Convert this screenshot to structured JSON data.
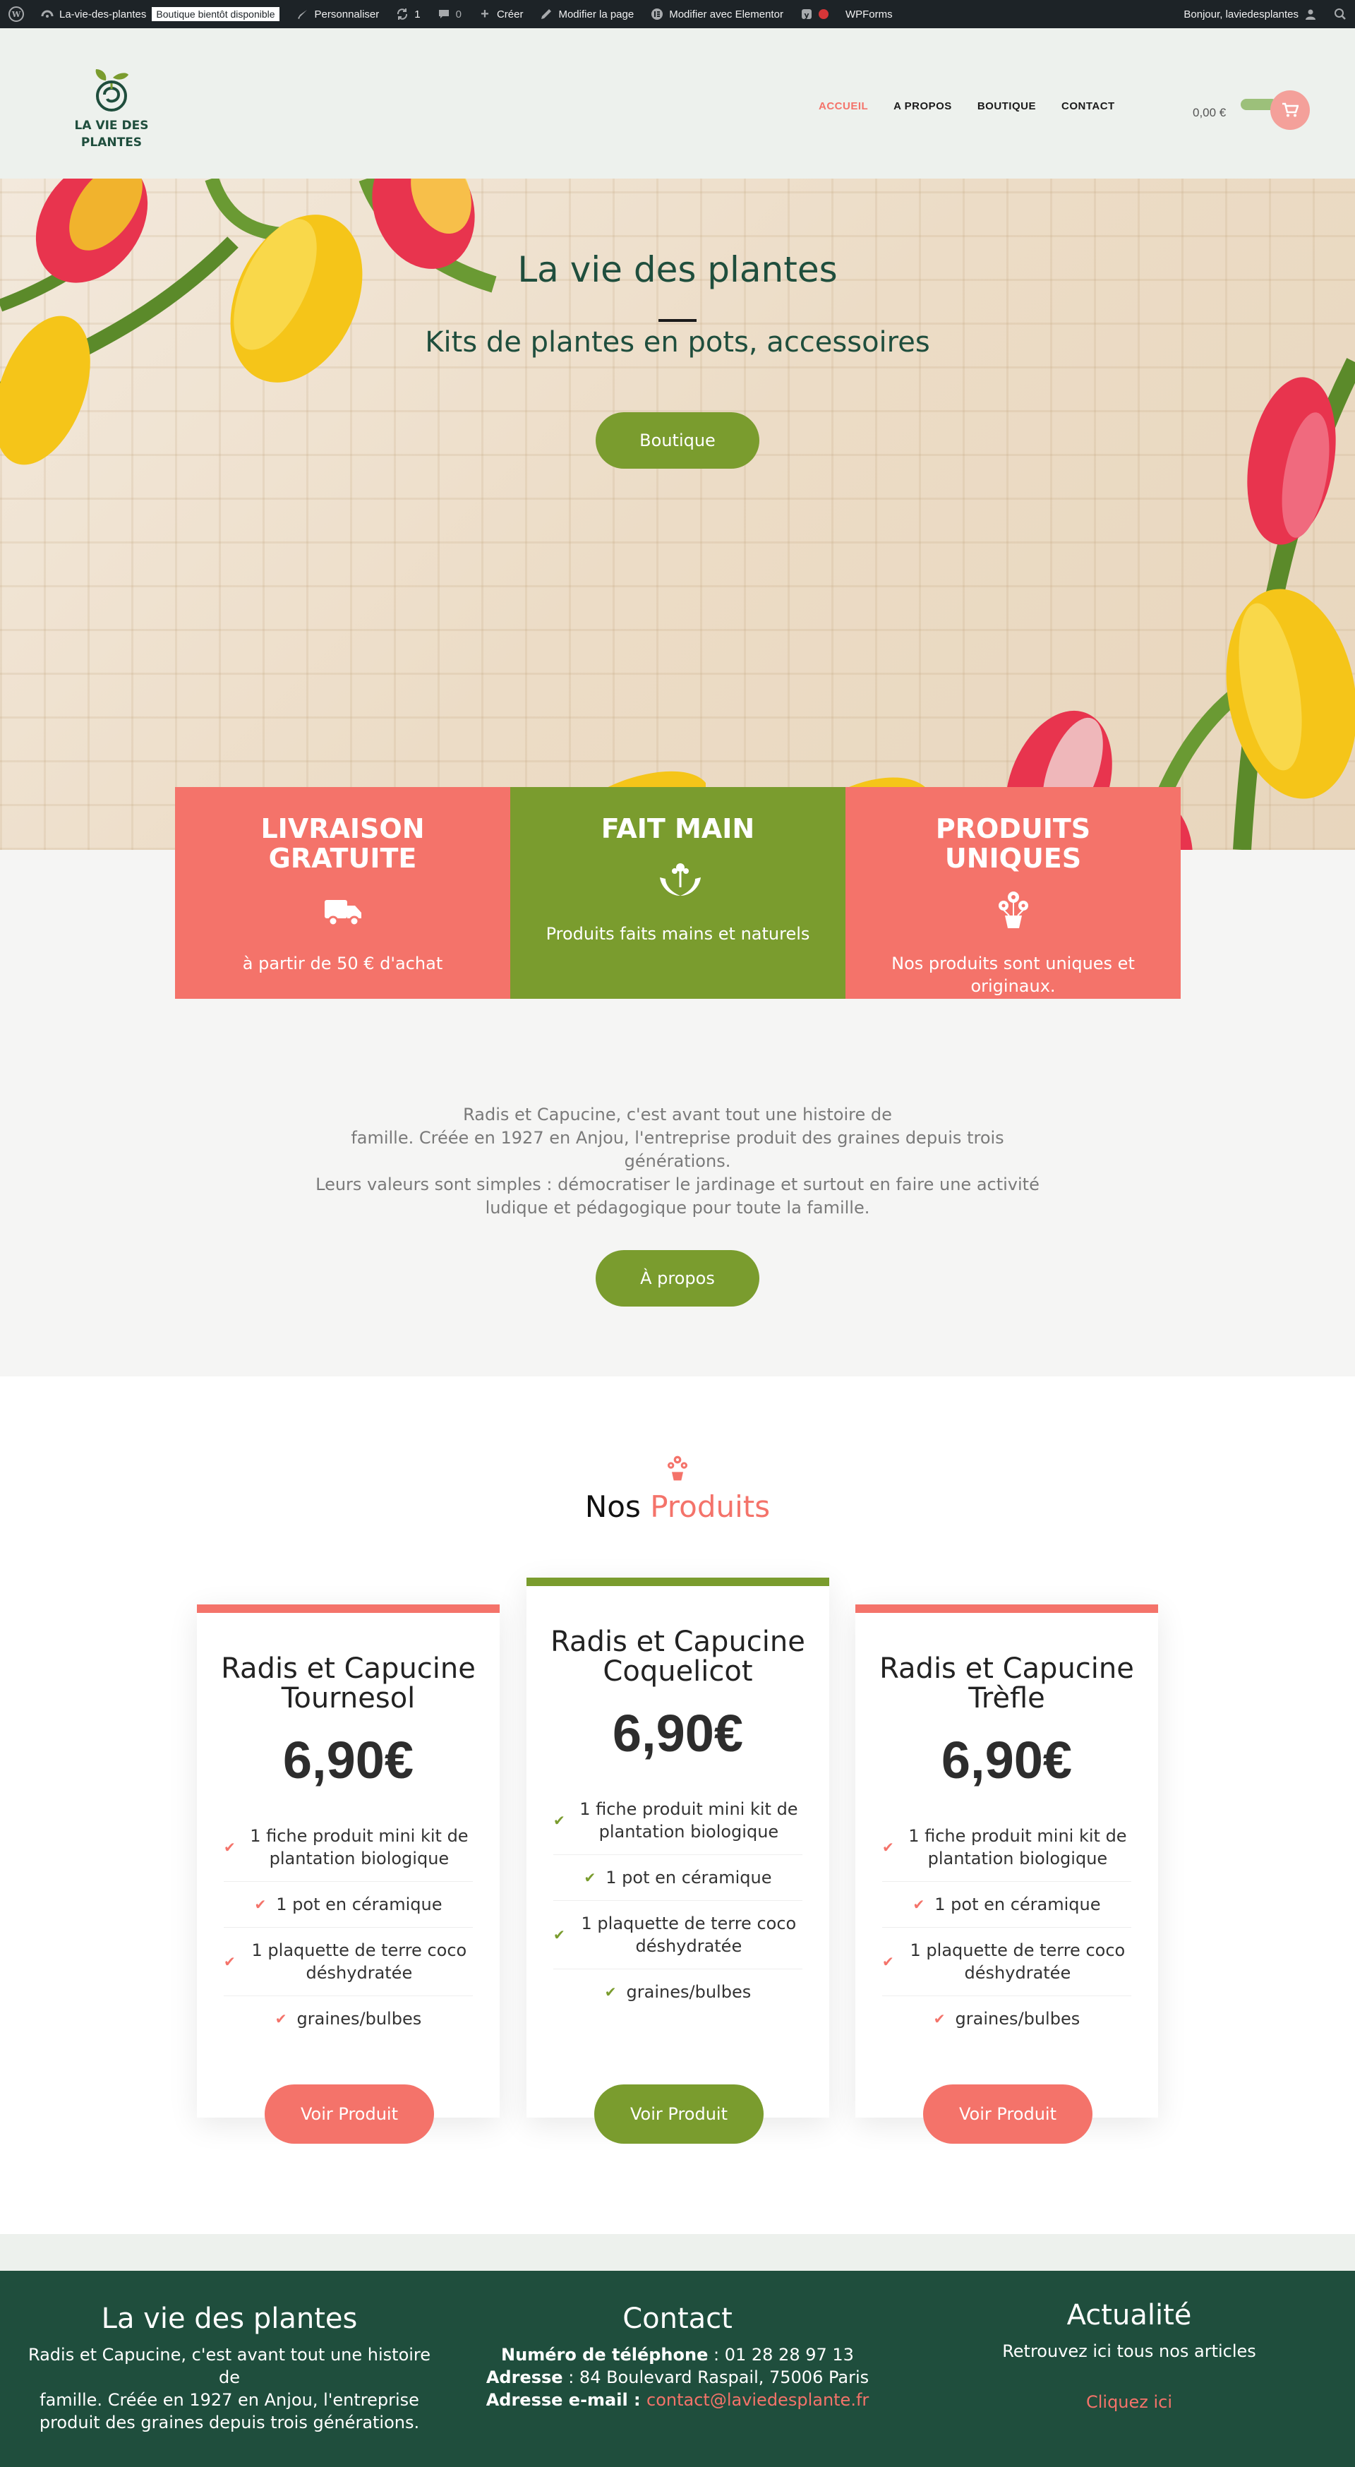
{
  "admin_bar": {
    "site_name": "La-vie-des-plantes",
    "coming_soon": "Boutique bientôt disponible",
    "customize": "Personnaliser",
    "updates": "1",
    "comments": "0",
    "create": "Créer",
    "edit_page": "Modifier la page",
    "edit_elementor": "Modifier avec Elementor",
    "wpforms": "WPForms",
    "greeting": "Bonjour, laviedesplantes"
  },
  "header": {
    "logo_line1": "LA VIE DES",
    "logo_line2": "PLANTES",
    "nav": [
      "ACCUEIL",
      "A PROPOS",
      "BOUTIQUE",
      "CONTACT"
    ],
    "cart_total": "0,00 €"
  },
  "hero": {
    "title": "La vie des plantes",
    "subtitle": "Kits de plantes en pots, accessoires",
    "button": "Boutique"
  },
  "features": [
    {
      "title": "LIVRAISON GRATUITE",
      "text": "à partir de 50 € d'achat",
      "icon": "truck-icon",
      "color": "#f4736a"
    },
    {
      "title": "FAIT MAIN",
      "text": "Produits faits mains et naturels",
      "icon": "hands-plant-icon",
      "color": "#7a9c2e"
    },
    {
      "title": "PRODUITS UNIQUES",
      "text": "Nos produits sont uniques et originaux.",
      "icon": "flowers-pot-icon",
      "color": "#f4736a"
    }
  ],
  "about": {
    "line1": "Radis et Capucine, c'est avant tout une histoire de",
    "line2": "famille. Créée en 1927 en Anjou, l'entreprise produit des graines depuis trois générations.",
    "line3": "Leurs valeurs sont simples : démocratiser le jardinage et surtout en faire une activité",
    "line4": "ludique et pédagogique pour toute la famille.",
    "button": "À propos"
  },
  "products": {
    "heading_prefix": "Nos",
    "heading_accent": "Produits",
    "items": [
      {
        "name_line1": "Radis et Capucine",
        "name_line2": "Tournesol",
        "price": "6,90€",
        "accent": "#f4736a",
        "features": [
          "1 fiche produit mini kit de plantation biologique",
          "1 pot en céramique",
          "1 plaquette de terre coco déshydratée",
          "graines/bulbes"
        ],
        "button": "Voir Produit"
      },
      {
        "name_line1": "Radis et Capucine",
        "name_line2": "Coquelicot",
        "price": "6,90€",
        "accent": "#7a9c2e",
        "features": [
          "1 fiche produit mini kit de plantation biologique",
          "1 pot en céramique",
          "1 plaquette de terre coco déshydratée",
          "graines/bulbes"
        ],
        "button": "Voir Produit"
      },
      {
        "name_line1": "Radis et Capucine",
        "name_line2": "Trèfle",
        "price": "6,90€",
        "accent": "#f4736a",
        "features": [
          "1 fiche produit mini kit de plantation biologique",
          "1 pot en céramique",
          "1 plaquette de terre coco déshydratée",
          "graines/bulbes"
        ],
        "button": "Voir Produit"
      }
    ]
  },
  "footer": {
    "col1_title": "La vie des plantes",
    "col1_line1": "Radis et Capucine, c'est avant tout une histoire",
    "col1_line2": "de",
    "col1_line3": "famille. Créée en 1927 en Anjou, l'entreprise",
    "col1_line4": "produit des graines depuis trois générations.",
    "col2_title": "Contact",
    "phone_label": "Numéro de téléphone",
    "phone": " : 01 28 28 97 13",
    "address_label": "Adresse",
    "address": " : 84 Boulevard Raspail, 75006 Paris",
    "email_label": "Adresse e-mail",
    "email_sep": " : ",
    "email": "contact@laviedesplante.fr",
    "col3_title": "Actualité",
    "col3_text": "Retrouvez ici tous nos articles",
    "col3_link": "Cliquez ici"
  }
}
